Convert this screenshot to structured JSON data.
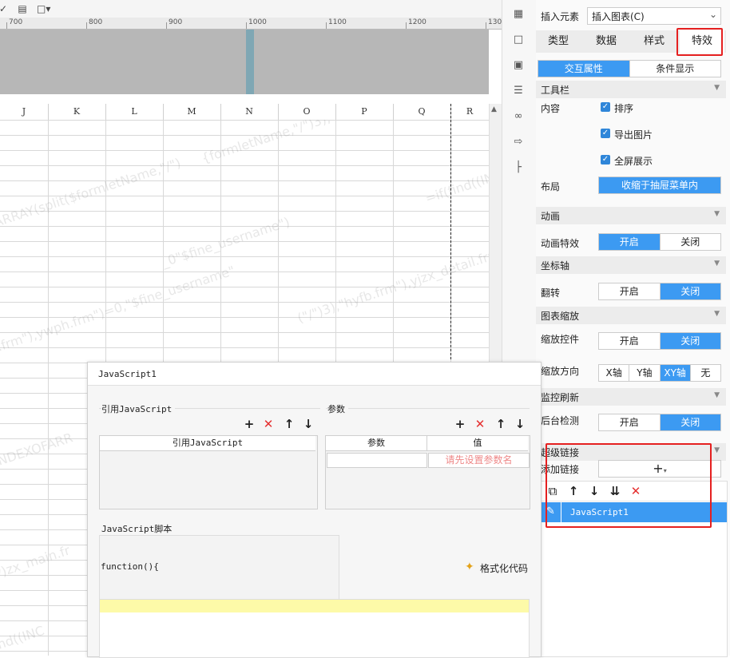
{
  "toolbar": {
    "icons": [
      "format-painter-icon",
      "document-icon",
      "border-icon"
    ]
  },
  "ruler": {
    "ticks": [
      "700",
      "800",
      "900",
      "1000",
      "1100",
      "1200",
      "130"
    ]
  },
  "sheet": {
    "columns": [
      "J",
      "K",
      "L",
      "M",
      "N",
      "O",
      "P",
      "Q",
      "R"
    ],
    "watermarks": [
      "{formletName,\"/\")3),\"hyfb.frm\"),y)",
      "ARRAY(split($formletName,\"/\")",
      "=if(find((IN",
      "_0\"$fine_username\")",
      "in.frm\"),ywph.frm\")=0,\"$fine_username\"",
      "(\"/\")3),\"hyfb.frm\"),yjzx_detail.frm",
      "INDEXOFARR",
      "y)zx_main.fr",
      "ind((INC"
    ]
  },
  "side_strip": {
    "icons": [
      "properties-icon",
      "frame-icon",
      "dropdown-widget-icon",
      "layers-icon",
      "link-icon",
      "import-icon",
      "tree-icon"
    ]
  },
  "panel": {
    "insert_label": "插入元素",
    "insert_value": "插入图表(C)",
    "tabs": [
      "类型",
      "数据",
      "样式",
      "特效"
    ],
    "subtabs": [
      "交互属性",
      "条件显示"
    ],
    "toolbar_section": "工具栏",
    "content_label": "内容",
    "checks": [
      "排序",
      "导出图片",
      "全屏展示"
    ],
    "layout_label": "布局",
    "layout_value": "收缩于抽屉菜单内",
    "animation_section": "动画",
    "animation_label": "动画特效",
    "axis_section": "坐标轴",
    "flip_label": "翻转",
    "zoom_section": "图表缩放",
    "zoom_control_label": "缩放控件",
    "zoom_direction_label": "缩放方向",
    "zoom_dirs": [
      "X轴",
      "Y轴",
      "XY轴",
      "无"
    ],
    "monitor_section": "监控刷新",
    "monitor_label": "后台检测",
    "on": "开启",
    "off": "关闭",
    "hyperlink_section": "超级链接",
    "add_link_label": "添加链接",
    "add_link_glyph": "+",
    "link_item": "JavaScript1",
    "accent": "#3c9af2",
    "highlight": "#e52020"
  },
  "dialog": {
    "title": "JavaScript1",
    "ref_group": "引用JavaScript",
    "ref_header": "引用JavaScript",
    "param_group": "参数",
    "param_header_name": "参数",
    "param_header_value": "值",
    "param_placeholder": "请先设置参数名",
    "script_group": "JavaScript脚本",
    "script_start": "function(){",
    "format_code": "格式化代码"
  }
}
